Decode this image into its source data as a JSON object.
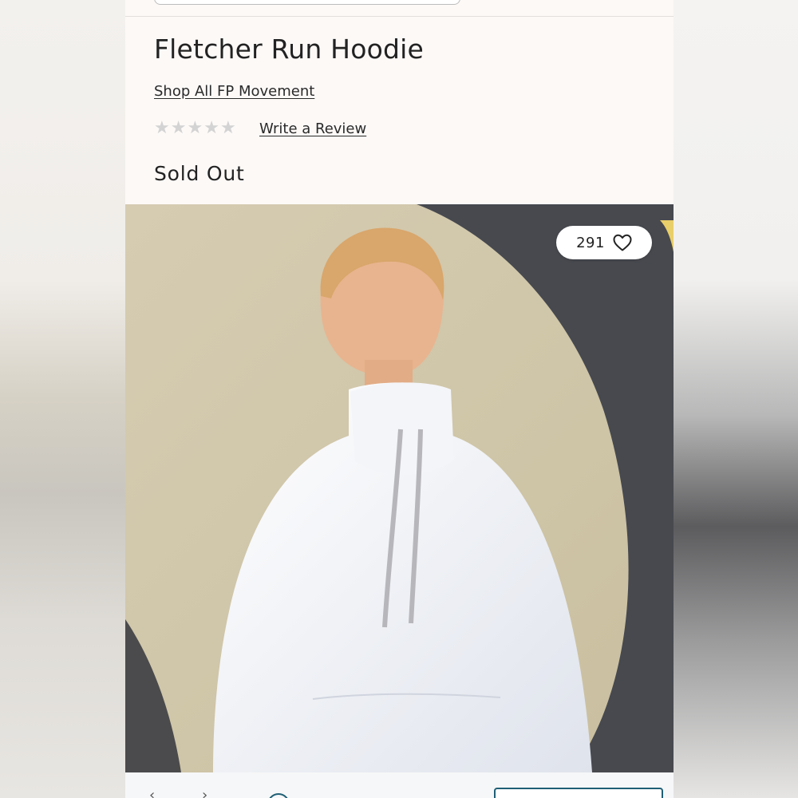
{
  "product": {
    "title": "Fletcher Run Hoodie",
    "shop_all_link": "Shop All FP Movement",
    "rating_stars": 0,
    "rating_max": 5,
    "write_review": "Write a Review",
    "availability": "Sold Out"
  },
  "favorites": {
    "count": "291",
    "icon": "heart-icon"
  },
  "colors": {
    "accent": "#1f5f75",
    "star_empty": "#d3d3d3",
    "text": "#222222",
    "page_bg": "#fcf9f7"
  }
}
